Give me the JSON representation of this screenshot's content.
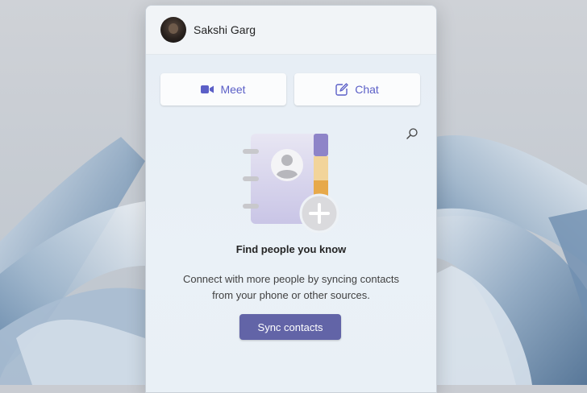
{
  "user": {
    "name": "Sakshi Garg"
  },
  "actions": {
    "meet_label": "Meet",
    "chat_label": "Chat"
  },
  "empty_state": {
    "title": "Find people you know",
    "description_line1": "Connect with more people by syncing contacts",
    "description_line2": "from your phone or other sources.",
    "button_label": "Sync contacts"
  },
  "icons": {
    "meet": "video-camera-icon",
    "chat": "compose-icon",
    "search": "search-icon"
  },
  "colors": {
    "accent": "#5b5fc7",
    "button_fill": "#6264a7"
  }
}
